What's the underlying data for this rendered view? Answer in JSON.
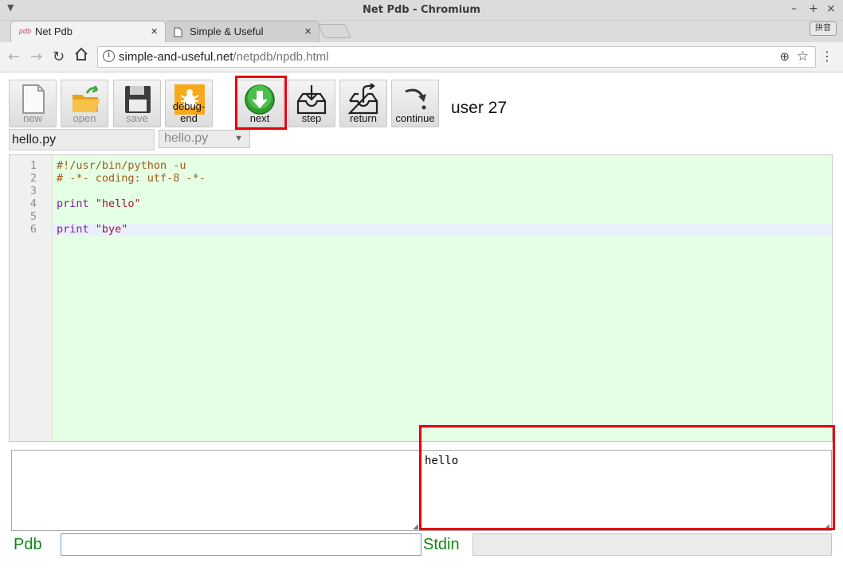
{
  "window": {
    "title": "Net Pdb - Chromium",
    "controls": [
      "–",
      "+",
      "×"
    ]
  },
  "tabs": [
    {
      "label": "Net Pdb",
      "favicon": "pdb",
      "active": true
    },
    {
      "label": "Simple & Useful",
      "favicon": "page-icon",
      "active": false
    }
  ],
  "ime_indicator": "拼音",
  "address_bar": {
    "host": "simple-and-useful.net",
    "path": "/netpdb/npdb.html"
  },
  "toolbar": {
    "buttons": [
      {
        "id": "new",
        "label": "new",
        "enabled": false,
        "icon": "new-file-icon"
      },
      {
        "id": "open",
        "label": "open",
        "enabled": false,
        "icon": "open-folder-icon"
      },
      {
        "id": "save",
        "label": "save",
        "enabled": false,
        "icon": "floppy-disk-icon"
      },
      {
        "id": "debug-end",
        "label": "debug-end",
        "enabled": true,
        "icon": "bug-icon"
      },
      {
        "id": "next",
        "label": "next",
        "enabled": true,
        "icon": "down-arrow-circle-icon"
      },
      {
        "id": "step",
        "label": "step",
        "enabled": true,
        "icon": "inbox-in-icon"
      },
      {
        "id": "return",
        "label": "return",
        "enabled": true,
        "icon": "inbox-out-icon"
      },
      {
        "id": "continue",
        "label": "continue",
        "enabled": true,
        "icon": "curved-arrow-icon"
      }
    ],
    "user_label": "user 27"
  },
  "file": {
    "name_value": "hello.py",
    "select_value": "hello.py"
  },
  "editor": {
    "lines": [
      {
        "num": "1",
        "text": "#!/usr/bin/python -u",
        "kind": "comment"
      },
      {
        "num": "2",
        "text": "# -*- coding: utf-8 -*-",
        "kind": "comment"
      },
      {
        "num": "3",
        "text": "",
        "kind": "plain"
      },
      {
        "num": "4",
        "keyword": "print",
        "string": "\"hello\"",
        "kind": "print"
      },
      {
        "num": "5",
        "text": "",
        "kind": "plain"
      },
      {
        "num": "6",
        "keyword": "print",
        "string": "\"bye\"",
        "kind": "print"
      }
    ],
    "current_line": "6",
    "colors": {
      "background": "#e5ffe5",
      "current_line": "#e9f0fb",
      "comment": "#a15a17",
      "keyword": "#7a1fa2",
      "string": "#a31533"
    }
  },
  "output": {
    "left_text": "",
    "right_text": "hello"
  },
  "command_bar": {
    "pdb_label": "Pdb",
    "pdb_value": "",
    "stdin_label": "Stdin",
    "stdin_value": ""
  },
  "accent": {
    "highlight_color": "#e8000b",
    "label_green": "#118611"
  }
}
